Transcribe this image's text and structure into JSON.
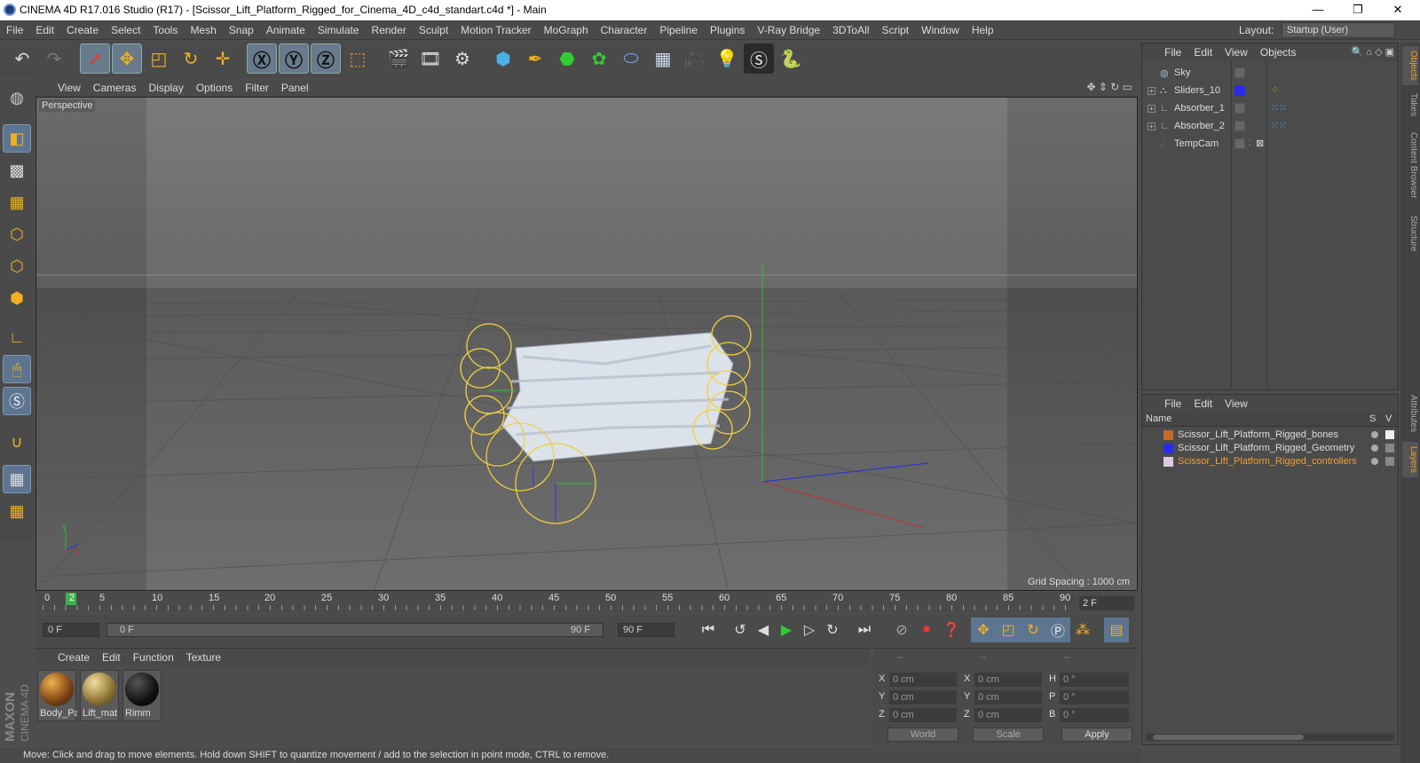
{
  "window": {
    "title": "CINEMA 4D R17.016 Studio (R17) - [Scissor_Lift_Platform_Rigged_for_Cinema_4D_c4d_standart.c4d *] - Main",
    "minimize": "—",
    "restore": "❐",
    "close": "✕"
  },
  "menubar": {
    "items": [
      "File",
      "Edit",
      "Create",
      "Select",
      "Tools",
      "Mesh",
      "Snap",
      "Animate",
      "Simulate",
      "Render",
      "Sculpt",
      "Motion Tracker",
      "MoGraph",
      "Character",
      "Pipeline",
      "Plugins",
      "V-Ray Bridge",
      "3DToAll",
      "Script",
      "Window",
      "Help"
    ]
  },
  "layout": {
    "label": "Layout:",
    "value": "Startup (User)"
  },
  "viewport": {
    "menu": [
      "View",
      "Cameras",
      "Display",
      "Options",
      "Filter",
      "Panel"
    ],
    "label": "Perspective",
    "grid_spacing": "Grid Spacing : 1000 cm"
  },
  "timeline": {
    "ticks": [
      "0",
      "5",
      "10",
      "15",
      "20",
      "25",
      "30",
      "35",
      "40",
      "45",
      "50",
      "55",
      "60",
      "65",
      "70",
      "75",
      "80",
      "85",
      "90"
    ],
    "current_frame": "2",
    "frame_field": "2 F"
  },
  "transport": {
    "start": "0 F",
    "range_start": "0 F",
    "range_end": "90 F",
    "end": "90 F"
  },
  "materials": {
    "menu": [
      "Create",
      "Edit",
      "Function",
      "Texture"
    ],
    "items": [
      {
        "label": "Body_Pa",
        "color": "#c07a20"
      },
      {
        "label": "Lift_mat",
        "color": "#b89a50"
      },
      {
        "label": "Rimm",
        "color": "#1a1a1a"
      }
    ]
  },
  "coords": {
    "headers": [
      "--",
      "--",
      "--"
    ],
    "rows": [
      {
        "a": "X",
        "av": "0 cm",
        "b": "X",
        "bv": "0 cm",
        "c": "H",
        "cv": "0 °"
      },
      {
        "a": "Y",
        "av": "0 cm",
        "b": "Y",
        "bv": "0 cm",
        "c": "P",
        "cv": "0 °"
      },
      {
        "a": "Z",
        "av": "0 cm",
        "b": "Z",
        "bv": "0 cm",
        "c": "B",
        "cv": "0 °"
      }
    ],
    "world": "World",
    "scale": "Scale",
    "apply": "Apply"
  },
  "objects": {
    "menu": [
      "File",
      "Edit",
      "View",
      "Objects"
    ],
    "items": [
      {
        "name": "Sky",
        "icon": "sky-icon",
        "expandable": false
      },
      {
        "name": "Sliders_10",
        "icon": "null-icon",
        "expandable": true
      },
      {
        "name": "Absorber_1",
        "icon": "bone-icon",
        "expandable": true
      },
      {
        "name": "Absorber_2",
        "icon": "bone-icon",
        "expandable": true
      },
      {
        "name": "TempCam",
        "icon": "camera-icon",
        "expandable": false
      }
    ]
  },
  "layers": {
    "menu": [
      "File",
      "Edit",
      "View"
    ],
    "header": {
      "name": "Name",
      "s": "S",
      "v": "V"
    },
    "items": [
      {
        "name": "Scissor_Lift_Platform_Rigged_bones",
        "color": "#c8672a"
      },
      {
        "name": "Scissor_Lift_Platform_Rigged_Geometry",
        "color": "#2a2aef"
      },
      {
        "name": "Scissor_Lift_Platform_Rigged_controllers",
        "color": "#e0c8e0"
      }
    ]
  },
  "sidetabs": [
    "Objects",
    "Takes",
    "Content Browser",
    "Structure",
    "Attributes",
    "Layers"
  ],
  "status": "Move: Click and drag to move elements. Hold down SHIFT to quantize movement / add to the selection in point mode, CTRL to remove.",
  "brand": {
    "line1": "MAXON",
    "line2": "CINEMA 4D"
  }
}
